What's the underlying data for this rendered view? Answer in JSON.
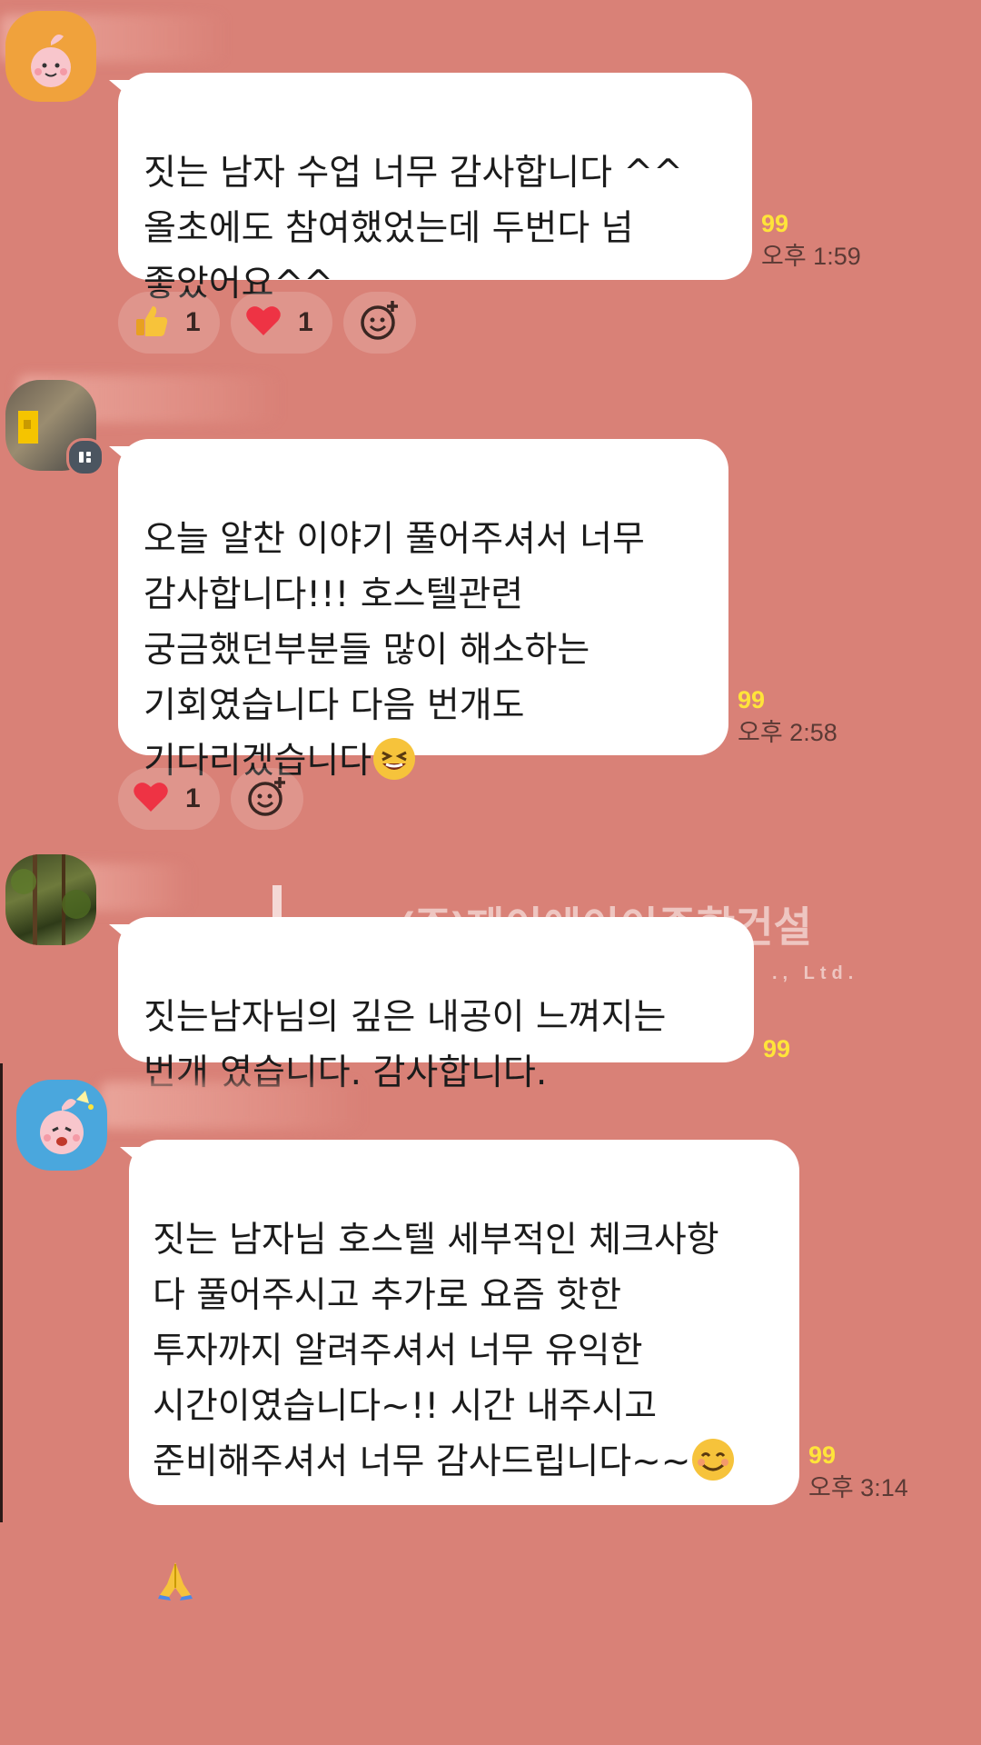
{
  "messages": [
    {
      "text": "짓는 남자 수업 너무 감사합니다 ^^\n올초에도 참여했었는데 두번다 넘\n좋았어요^^",
      "unread": "99",
      "time": "오후 1:59",
      "avatar": "peach-character-icon",
      "reactions": [
        {
          "icon": "thumbs-up-icon",
          "count": "1"
        },
        {
          "icon": "heart-icon",
          "count": "1"
        }
      ]
    },
    {
      "text": "오늘 알찬 이야기 풀어주셔서 너무\n감사합니다!!! 호스텔관련\n궁금했던부분들 많이 해소하는\n기회였습니다 다음 번개도\n기다리겠습니다",
      "text_emoji": "laughing-face-icon",
      "unread": "99",
      "time": "오후 2:58",
      "avatar": "yellow-photo-avatar",
      "reactions": [
        {
          "icon": "heart-icon",
          "count": "1"
        }
      ]
    },
    {
      "text": "짓는남자님의 깊은 내공이 느껴지는\n번개 였습니다. 감사합니다.",
      "unread": "99",
      "avatar": "forest-photo-avatar"
    },
    {
      "text": "짓는 남자님 호스텔 세부적인 체크사항\n다 풀어주시고 추가로 요즘 핫한\n투자까지 알려주셔서 너무 유익한\n시간이였습니다~!! 시간 내주시고\n준비해주셔서 너무 감사드립니다~~",
      "text_emoji": "smiling-face-icon",
      "text_emoji_2": "folded-hands-icon",
      "unread": "99",
      "time": "오후 3:14",
      "avatar": "peach-character-blue-icon"
    }
  ],
  "watermark": {
    "company": "(주)제이에이이종합건설",
    "sub": "., Ltd."
  },
  "colors": {
    "background": "#d98177",
    "bubble": "#ffffff",
    "unread": "#ffe43a"
  }
}
